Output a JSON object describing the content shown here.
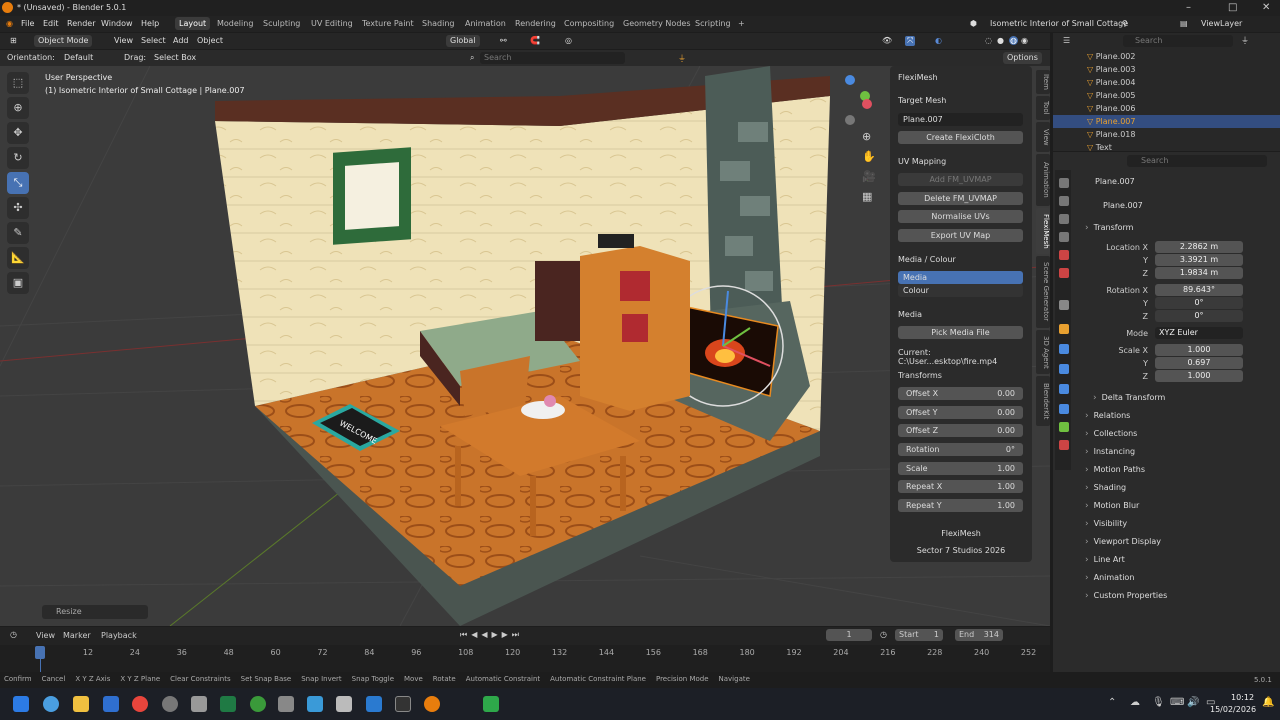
{
  "window": {
    "title": "* (Unsaved) - Blender 5.0.1"
  },
  "menu": {
    "items": [
      "File",
      "Edit",
      "Render",
      "Window",
      "Help"
    ],
    "workspaces": [
      "Layout",
      "Modeling",
      "Sculpting",
      "UV Editing",
      "Texture Paint",
      "Shading",
      "Animation",
      "Rendering",
      "Compositing",
      "Geometry Nodes",
      "Scripting"
    ],
    "active_workspace": "Layout",
    "scene": "Isometric Interior of Small Cottage",
    "view_layer": "ViewLayer"
  },
  "viewport_header": {
    "mode": "Object Mode",
    "view": "View",
    "select": "Select",
    "add": "Add",
    "object": "Object",
    "transform_orientation": "Global"
  },
  "tool_settings": {
    "orientation_label": "Orientation:",
    "orientation": "Default",
    "drag_label": "Drag:",
    "drag": "Select Box",
    "search_placeholder": "Search",
    "options": "Options"
  },
  "viewport": {
    "perspective": "User Perspective",
    "context": "(1) Isometric Interior of Small Cottage | Plane.007",
    "welcome_mat": "WELCOME",
    "last_op": "Resize"
  },
  "npanel": {
    "title": "FlexiMesh",
    "target_mesh_label": "Target Mesh",
    "target_mesh": "Plane.007",
    "create_btn": "Create FlexiCloth",
    "uv_label": "UV Mapping",
    "add_uv": "Add FM_UVMAP",
    "delete_uv": "Delete FM_UVMAP",
    "normalise": "Normalise UVs",
    "export_uv": "Export UV Map",
    "media_colour_label": "Media / Colour",
    "media_opt": "Media",
    "colour_opt": "Colour",
    "media_label": "Media",
    "pick_media": "Pick Media File",
    "current": "Current: C:\\User...esktop\\fire.mp4",
    "transforms_label": "Transforms",
    "fields": [
      {
        "label": "Offset X",
        "value": "0.00"
      },
      {
        "label": "Offset Y",
        "value": "0.00"
      },
      {
        "label": "Offset Z",
        "value": "0.00"
      },
      {
        "label": "Rotation",
        "value": "0°"
      },
      {
        "label": "Scale",
        "value": "1.00"
      },
      {
        "label": "Repeat X",
        "value": "1.00"
      },
      {
        "label": "Repeat Y",
        "value": "1.00"
      }
    ],
    "footer1": "FlexiMesh",
    "footer2": "Sector 7 Studios 2026",
    "tabs": [
      "Item",
      "Tool",
      "View",
      "Animation",
      "FlexiMesh",
      "Scene Generator",
      "3D Agent",
      "BlenderKit"
    ]
  },
  "outliner": {
    "search_placeholder": "Search",
    "rows": [
      "Plane.002",
      "Plane.003",
      "Plane.004",
      "Plane.005",
      "Plane.006",
      "Plane.007",
      "Plane.018",
      "Text"
    ],
    "selected": "Plane.007"
  },
  "properties": {
    "search_placeholder": "Search",
    "object": "Plane.007",
    "data": "Plane.007",
    "transform_label": "Transform",
    "location_label": "Location X",
    "loc": [
      "2.2862 m",
      "3.3921 m",
      "1.9834 m"
    ],
    "rotation_label": "Rotation X",
    "rot": [
      "89.643°",
      "0°",
      "0°"
    ],
    "mode_label": "Mode",
    "mode": "XYZ Euler",
    "scale_label": "Scale X",
    "scale": [
      "1.000",
      "0.697",
      "1.000"
    ],
    "axis_y": "Y",
    "axis_z": "Z",
    "sections": [
      "Delta Transform",
      "Relations",
      "Collections",
      "Instancing",
      "Motion Paths",
      "Shading",
      "Motion Blur",
      "Visibility",
      "Viewport Display",
      "Line Art",
      "Animation",
      "Custom Properties"
    ]
  },
  "timeline": {
    "view": "View",
    "marker": "Marker",
    "playback": "Playback",
    "current_frame": "1",
    "start_label": "Start",
    "start": "1",
    "end_label": "End",
    "end": "314",
    "ticks": [
      "1",
      "12",
      "24",
      "36",
      "48",
      "60",
      "72",
      "84",
      "96",
      "108",
      "120",
      "132",
      "144",
      "156",
      "168",
      "180",
      "192",
      "204",
      "216",
      "228",
      "240",
      "252"
    ]
  },
  "statusbar": {
    "items": [
      "Confirm",
      "Cancel",
      "X Y Z Axis",
      "X Y Z Plane",
      "Clear Constraints",
      "Set Snap Base",
      "Snap Invert",
      "Snap Toggle",
      "Move",
      "Rotate",
      "Automatic Constraint",
      "Automatic Constraint Plane",
      "Precision Mode",
      "Navigate"
    ],
    "version": "5.0.1"
  },
  "taskbar": {
    "time": "10:12",
    "date": "15/02/2026"
  }
}
